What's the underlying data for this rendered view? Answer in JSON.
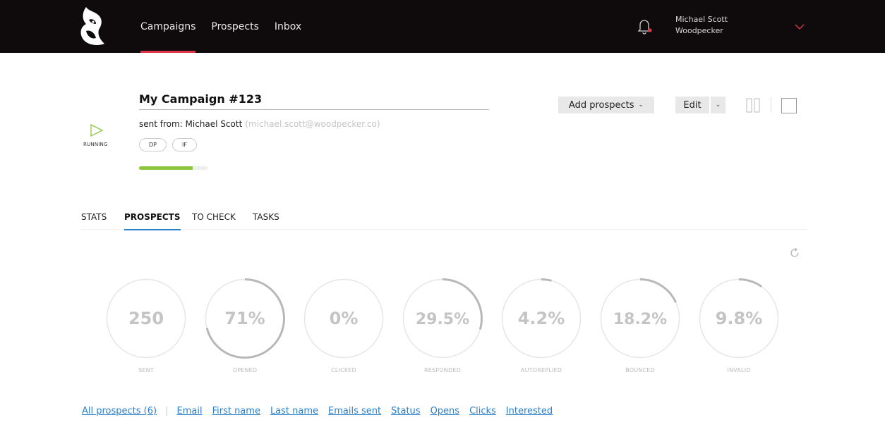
{
  "nav": {
    "items": [
      {
        "label": "Campaigns",
        "active": true
      },
      {
        "label": "Prospects",
        "active": false
      },
      {
        "label": "Inbox",
        "active": false
      }
    ]
  },
  "user": {
    "name": "Michael Scott",
    "company": "Woodpecker"
  },
  "campaign": {
    "title": "My Campaign #123",
    "status": "RUNNING",
    "sent_from_label": "sent from: Michael Scott",
    "sent_from_email": "(michael.scott@woodpecker.co)",
    "tags": [
      "DP",
      "IF"
    ],
    "progress": 0.78
  },
  "actions": {
    "add_prospects": "Add prospects",
    "edit": "Edit"
  },
  "tabs": [
    {
      "label": "STATS",
      "active": false
    },
    {
      "label": "PROSPECTS",
      "active": true
    },
    {
      "label": "TO CHECK",
      "active": false
    },
    {
      "label": "TASKS",
      "active": false
    }
  ],
  "stats": [
    {
      "value": "250",
      "label": "SENT",
      "fraction": 0
    },
    {
      "value": "71%",
      "label": "OPENED",
      "fraction": 0.71
    },
    {
      "value": "0%",
      "label": "CLICKED",
      "fraction": 0
    },
    {
      "value": "29.5%",
      "label": "RESPONDED",
      "fraction": 0.295
    },
    {
      "value": "4.2%",
      "label": "AUTOREPLIED",
      "fraction": 0.042
    },
    {
      "value": "18.2%",
      "label": "BOUNCED",
      "fraction": 0.182
    },
    {
      "value": "9.8%",
      "label": "INVALID",
      "fraction": 0.098
    }
  ],
  "filters": {
    "all": "All prospects (6)",
    "columns": [
      "Email",
      "First name",
      "Last name",
      "Emails sent",
      "Status",
      "Opens",
      "Clicks",
      "Interested"
    ]
  },
  "colors": {
    "topbar": "#0f0a0b",
    "accent": "#e0344b",
    "link": "#2b7fc9",
    "progress": "#8dc63f"
  }
}
